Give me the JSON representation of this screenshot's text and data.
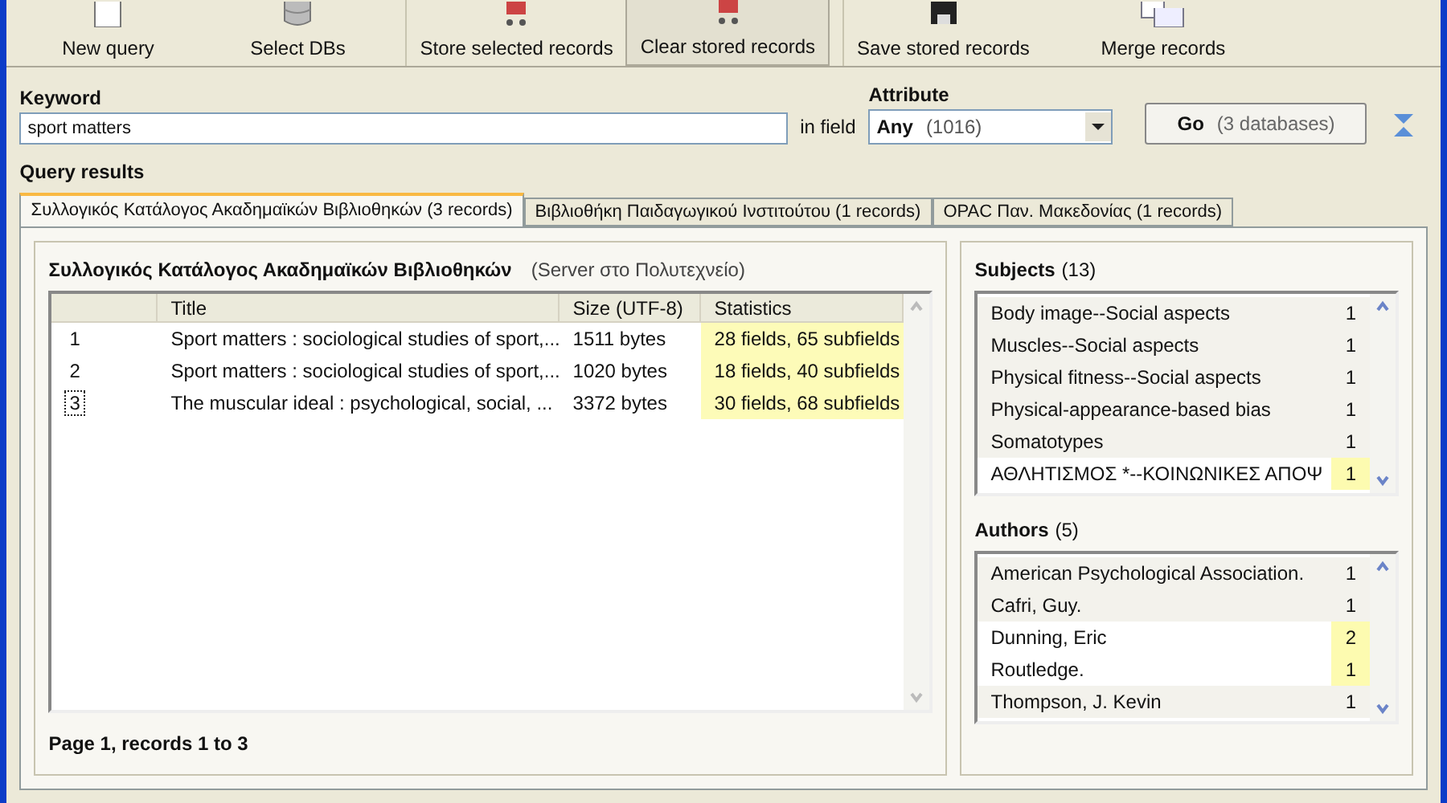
{
  "toolbar": [
    {
      "label": "New query",
      "kind": "page",
      "pressed": false
    },
    {
      "label": "Select DBs",
      "kind": "database",
      "pressed": false
    },
    {
      "label": "Store selected records",
      "kind": "cart",
      "pressed": false
    },
    {
      "label": "Clear stored records",
      "kind": "cart",
      "pressed": true
    },
    {
      "label": "Save stored records",
      "kind": "disk",
      "pressed": false
    },
    {
      "label": "Merge records",
      "kind": "pages",
      "pressed": false
    }
  ],
  "search": {
    "keyword_label": "Keyword",
    "keyword_value": "sport matters",
    "in_field_label": "in field",
    "attribute_label": "Attribute",
    "attribute_value": "Any",
    "attribute_count": "(1016)",
    "go_label": "Go",
    "go_note": "(3 databases)"
  },
  "results_title": "Query results",
  "tabs": [
    {
      "label": "Συλλογικός Κατάλογος Ακαδημαϊκών Βιβλιοθηκών (3 records)",
      "selected": true
    },
    {
      "label": "Βιβλιοθήκη Παιδαγωγικού Ινστιτούτου (1 records)",
      "selected": false
    },
    {
      "label": "OPAC Παν. Μακεδονίας (1 records)",
      "selected": false
    }
  ],
  "records": {
    "title": "Συλλογικός Κατάλογος Ακαδημαϊκών Βιβλιοθηκών",
    "server": "(Server στο Πολυτεχνείο)",
    "columns": [
      "Title",
      "Size (UTF-8)",
      "Statistics"
    ],
    "rows": [
      {
        "number": "1",
        "title": "Sport matters : sociological studies of sport,...",
        "size": "1511 bytes",
        "statistics": "28 fields, 65 subfields",
        "focused": false
      },
      {
        "number": "2",
        "title": "Sport matters : sociological studies of sport,...",
        "size": "1020 bytes",
        "statistics": "18 fields, 40 subfields",
        "focused": false
      },
      {
        "number": "3",
        "title": "The muscular ideal : psychological, social, ...",
        "size": "3372 bytes",
        "statistics": "30 fields, 68 subfields",
        "focused": true
      }
    ],
    "status": "Page 1, records 1 to 3"
  },
  "subjects": {
    "title": "Subjects",
    "count": "(13)",
    "items": [
      {
        "name": "Body image--Social aspects",
        "count": "1",
        "highlighted": false
      },
      {
        "name": "Muscles--Social aspects",
        "count": "1",
        "highlighted": false
      },
      {
        "name": "Physical fitness--Social aspects",
        "count": "1",
        "highlighted": false
      },
      {
        "name": "Physical-appearance-based bias",
        "count": "1",
        "highlighted": false
      },
      {
        "name": "Somatotypes",
        "count": "1",
        "highlighted": false
      },
      {
        "name": "ΑΘΛΗΤΙΣΜΟΣ *--ΚΟΙΝΩΝΙΚΕΣ ΑΠΟΨ",
        "count": "1",
        "highlighted": true
      }
    ]
  },
  "authors": {
    "title": "Authors",
    "count": "(5)",
    "items": [
      {
        "name": "American Psychological Association.",
        "count": "1",
        "highlighted": false
      },
      {
        "name": "Cafri, Guy.",
        "count": "1",
        "highlighted": false
      },
      {
        "name": "Dunning, Eric",
        "count": "2",
        "highlighted": true
      },
      {
        "name": "Routledge.",
        "count": "1",
        "highlighted": true
      },
      {
        "name": "Thompson, J. Kevin",
        "count": "1",
        "highlighted": false
      }
    ]
  }
}
